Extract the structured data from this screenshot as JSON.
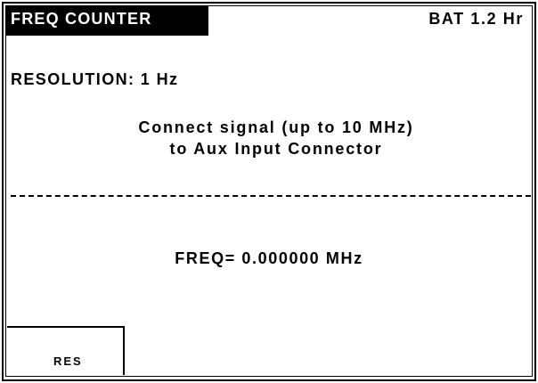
{
  "header": {
    "title": "FREQ COUNTER",
    "battery": "BAT  1.2 Hr"
  },
  "settings": {
    "resolution": "RESOLUTION: 1 Hz"
  },
  "instructions": {
    "line1": "Connect signal (up to 10 MHz)",
    "line2": "to Aux Input Connector"
  },
  "readout": {
    "frequency": "FREQ= 0.000000 MHz"
  },
  "softkeys": {
    "res_label": "RES"
  },
  "colors": {
    "background": "#ffffff",
    "foreground": "#000000",
    "title_bg": "#000000",
    "title_fg": "#ffffff"
  }
}
